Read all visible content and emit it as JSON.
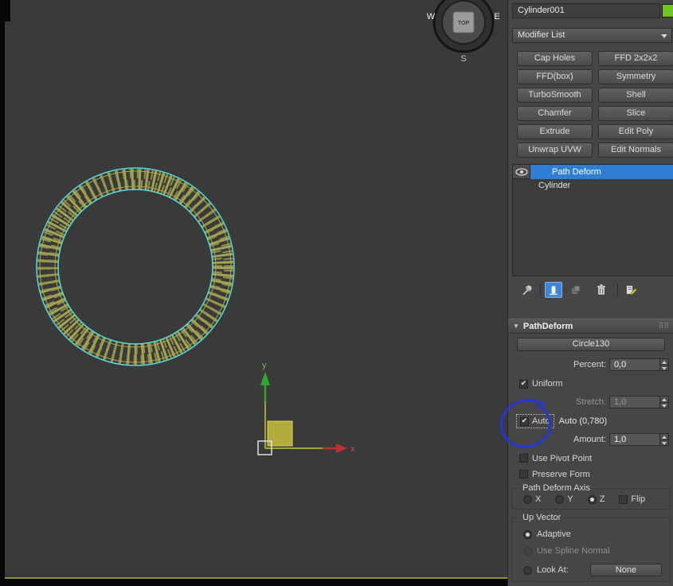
{
  "viewport": {
    "viewcube": {
      "center": "TOP",
      "west": "W",
      "east": "E",
      "south": "S"
    },
    "gizmo": {
      "x_label": "x",
      "y_label": "y"
    }
  },
  "header": {
    "object_name": "Cylinder001"
  },
  "modifier_list": {
    "label": "Modifier List"
  },
  "modifier_buttons": [
    "Cap Holes",
    "FFD 2x2x2",
    "FFD(box)",
    "Symmetry",
    "TurboSmooth",
    "Shell",
    "Chamfer",
    "Slice",
    "Extrude",
    "Edit Poly",
    "Unwrap UVW",
    "Edit Normals"
  ],
  "stack": {
    "items": [
      {
        "label": "Path Deform",
        "selected": true
      },
      {
        "label": "Cylinder",
        "selected": false
      }
    ]
  },
  "rollout": {
    "title": "PathDeform",
    "path_button": "Circle130",
    "percent_label": "Percent:",
    "percent_value": "0,0",
    "uniform_label": "Uniform",
    "stretch_label": "Stretch:",
    "stretch_value": "1,0",
    "auto_label": "Auto",
    "auto_value_text": "Auto (0,780)",
    "amount_label": "Amount:",
    "amount_value": "1,0",
    "use_pivot_label": "Use Pivot Point",
    "preserve_form_label": "Preserve Form",
    "axis_group_label": "Path Deform Axis",
    "axis_options": [
      "X",
      "Y",
      "Z"
    ],
    "flip_label": "Flip",
    "up_vector_label": "Up Vector",
    "adaptive_label": "Adaptive",
    "spline_normal_label": "Use Spline Normal",
    "look_at_label": "Look At:",
    "look_at_button": "None"
  },
  "icons": {
    "check": "✔",
    "rollout_tri": "▼",
    "grip": "⠿⠿"
  },
  "colors": {
    "selection_blue": "#2e7fd4",
    "toolbar_active_blue": "#3f84d6",
    "swatch_green": "#6fc41f",
    "annotation_blue": "#2636d6",
    "wire_cyan": "#52dcdc",
    "wire_olive": "#a3a352",
    "axis_red": "#c03030",
    "axis_green": "#2fa82f",
    "axis_yellow": "#c6c642",
    "square_olive": "#b3aa3e"
  }
}
